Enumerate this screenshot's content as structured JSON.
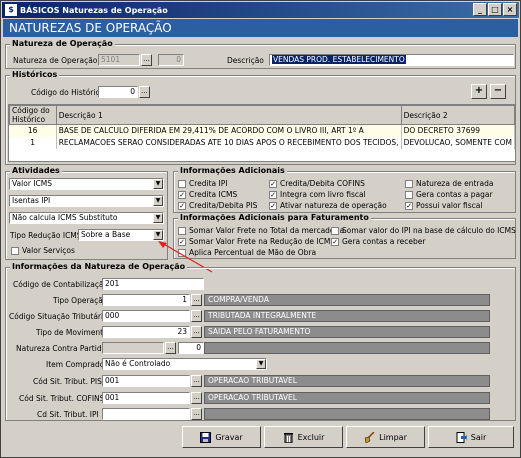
{
  "window": {
    "title": "BÁSICOS Naturezas de Operação",
    "banner": "NATUREZAS DE OPERAÇÃO",
    "min": "_",
    "max": "□",
    "close": "×"
  },
  "natureza": {
    "group_title": "Natureza de Operação",
    "label": "Natureza de Operação",
    "code": "5101",
    "sub": "0",
    "desc_label": "Descrição",
    "desc_value": "VENDAS PROD. ESTABELECIMENTO"
  },
  "historicos": {
    "group_title": "Históricos",
    "code_label": "Código do Histórico",
    "code_value": "0",
    "add": "+",
    "remove": "−",
    "columns": [
      "Código do Histórico",
      "Descrição 1",
      "Descrição 2"
    ],
    "rows": [
      [
        "16",
        "BASE DE CALCULO DIFERIDA EM 29,411% DE ACORDO COM O LIVRO III, ART 1º A",
        "DO DECRETO 37699"
      ],
      [
        "1",
        "RECLAMACOES SERAO CONSIDERADAS ATE 10 DIAS APOS O RECEBIMENTO DOS TECIDOS,",
        "DEVOLUCAO, SOMENTE COM"
      ]
    ]
  },
  "atividades": {
    "group_title": "Atividades",
    "selects": [
      "Valor ICMS",
      "Isentas IPI",
      "Não calcula ICMS Substituto"
    ],
    "tipo_label": "Tipo Redução ICMS",
    "tipo_value": "Sobre a Base",
    "valor_servicos": "Valor Serviços"
  },
  "info_adicionais": {
    "group_title": "Informações Adicionais",
    "items": [
      {
        "label": "Credita IPI",
        "checked": false
      },
      {
        "label": "Credita/Debita COFINS",
        "checked": true
      },
      {
        "label": "Natureza de entrada",
        "checked": false
      },
      {
        "label": "Credita ICMS",
        "checked": true
      },
      {
        "label": "Integra com livro fiscal",
        "checked": true
      },
      {
        "label": "Gera contas a pagar",
        "checked": false
      },
      {
        "label": "Credita/Debita PIS",
        "checked": true
      },
      {
        "label": "Ativar natureza de operação",
        "checked": true
      },
      {
        "label": "Possui valor fiscal",
        "checked": true
      }
    ]
  },
  "info_faturamento": {
    "group_title": "Informações Adicionais para Faturamento",
    "items": [
      {
        "label": "Somar Valor Frete no Total da mercadoria",
        "checked": false
      },
      {
        "label": "Somar valor do IPI na base de cálculo do ICMS",
        "checked": false
      },
      {
        "label": "Somar Valor Frete na Redução de ICMS",
        "checked": true
      },
      {
        "label": "Gera contas a receber",
        "checked": true
      },
      {
        "label": "Aplica Percentual de Mão de Obra",
        "checked": false
      }
    ]
  },
  "info_natureza": {
    "group_title": "Informações da Natureza de Operação",
    "contab_label": "Código de Contabilização",
    "contab_value": "201",
    "tipo_op_label": "Tipo Operação",
    "tipo_op_value": "1",
    "tipo_op_desc": "COMPRA/VENDA",
    "cst_label": "Código Situação Tributária",
    "cst_value": "000",
    "cst_desc": "TRIBUTADA INTEGRALMENTE",
    "tipo_mov_label": "Tipo de Movimento",
    "tipo_mov_value": "23",
    "tipo_mov_desc": "SAIDA PELO FATURAMENTO",
    "contra_label": "Natureza Contra Partida",
    "contra_value": "0",
    "item_label": "Item Comprado",
    "item_value": "Não é Controlado",
    "pis_label": "Cód Sit. Tribut. PIS",
    "pis_value": "001",
    "pis_desc": "OPERACAO TRIBUTAVEL",
    "cofins_label": "Cód Sit. Tribut. COFINS",
    "cofins_value": "001",
    "cofins_desc": "OPERACAO TRIBUTAVEL",
    "ipi_label": "Cd Sit. Tribut. IPI",
    "ipi_value": ""
  },
  "buttons": {
    "gravar": "Gravar",
    "excluir": "Excluir",
    "limpar": "Limpar",
    "sair": "Sair"
  }
}
